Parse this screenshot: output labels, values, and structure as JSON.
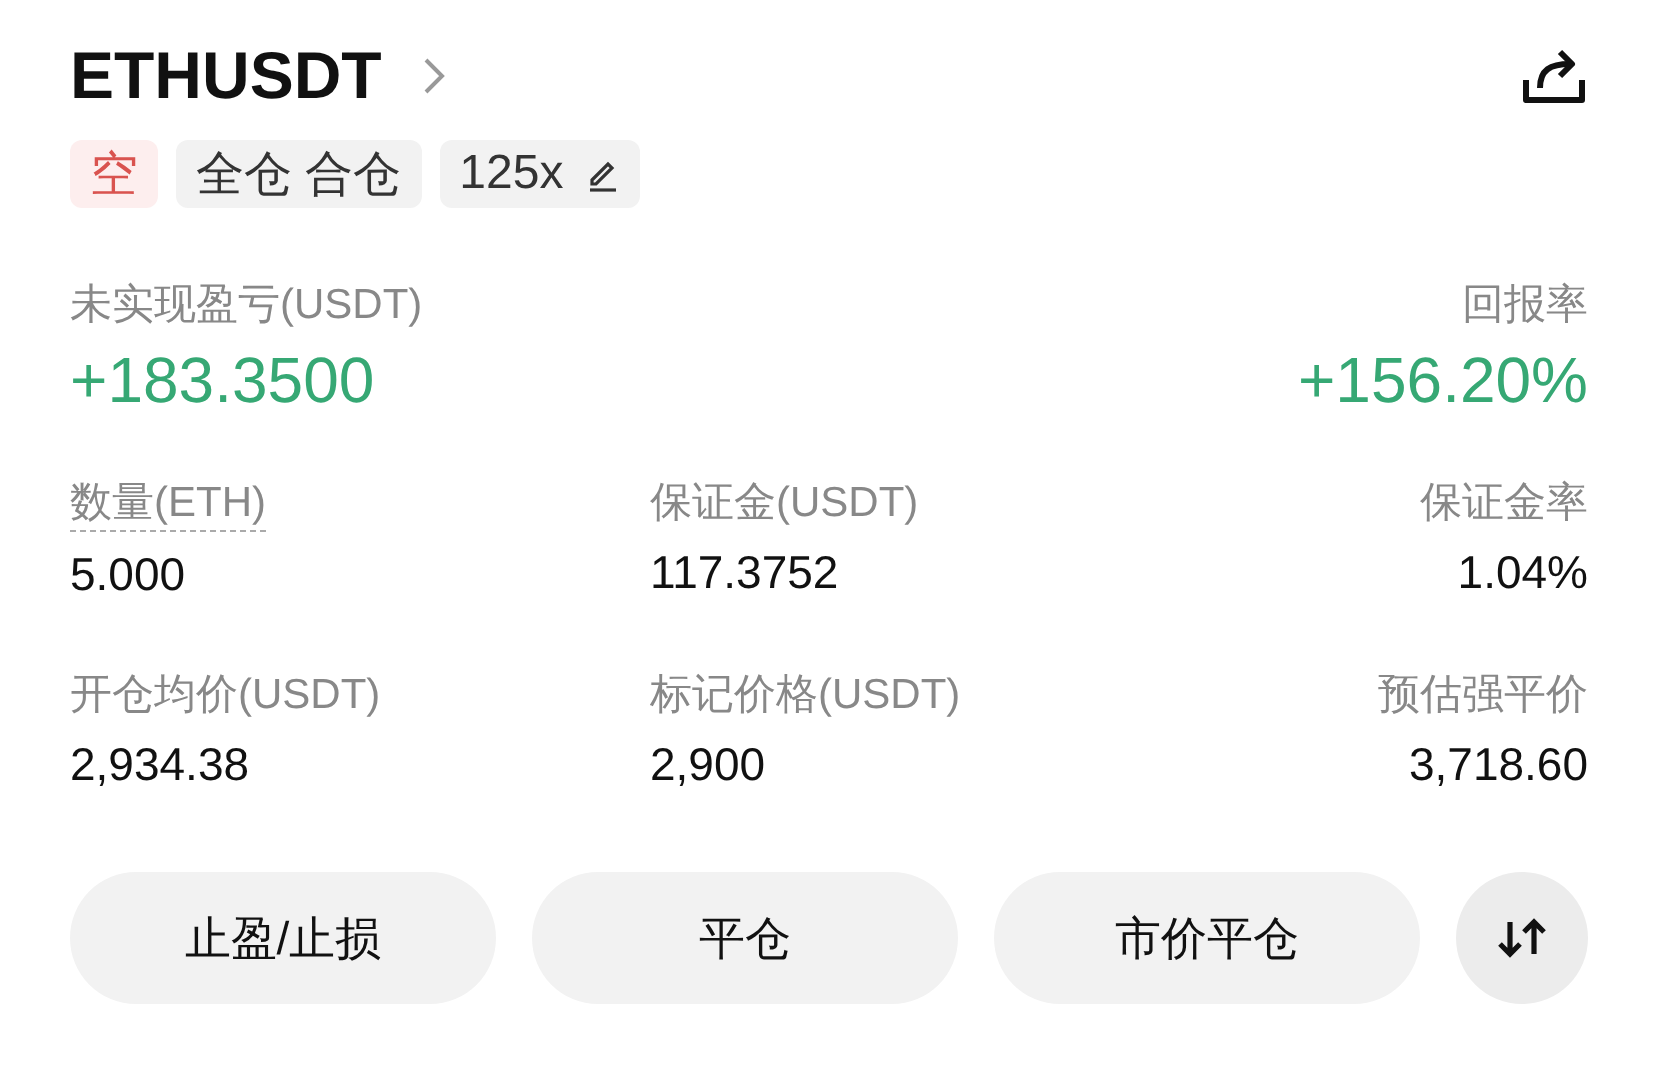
{
  "header": {
    "symbol": "ETHUSDT"
  },
  "tags": [
    {
      "kind": "side",
      "label": "空"
    },
    {
      "kind": "mode",
      "label": "全仓 合仓"
    },
    {
      "kind": "leverage",
      "label": "125x"
    }
  ],
  "pnl": {
    "label": "未实现盈亏(USDT)",
    "value": "+183.3500"
  },
  "roe": {
    "label": "回报率",
    "value": "+156.20%"
  },
  "stats": [
    {
      "label": "数量(ETH)",
      "value": "5.000",
      "underlined": true
    },
    {
      "label": "保证金(USDT)",
      "value": "117.3752",
      "underlined": false
    },
    {
      "label": "保证金率",
      "value": "1.04%",
      "underlined": false
    },
    {
      "label": "开仓均价(USDT)",
      "value": "2,934.38",
      "underlined": false
    },
    {
      "label": "标记价格(USDT)",
      "value": "2,900",
      "underlined": false
    },
    {
      "label": "预估强平价",
      "value": "3,718.60",
      "underlined": false
    }
  ],
  "buttons": [
    "止盈/止损",
    "平仓",
    "市价平仓"
  ]
}
